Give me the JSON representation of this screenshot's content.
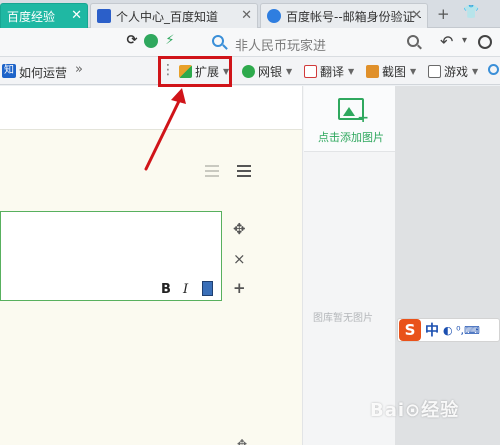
{
  "tabs": [
    {
      "label": "百度经验",
      "active": true,
      "close": "✕"
    },
    {
      "label": "个人中心_百度知道",
      "active": false,
      "close": "✕"
    },
    {
      "label": "百度帐号--邮箱身份验证 -",
      "active": false,
      "close": "✕"
    }
  ],
  "tabbar": {
    "new_tab": "+",
    "skin": "👕"
  },
  "addressbar": {
    "text": "非人民币玩家进",
    "undo": "↶",
    "caret": "▾"
  },
  "bookmarks": {
    "label": "如何运营",
    "icon_text": "知",
    "more": "»"
  },
  "toolbar_dots": "⋮",
  "extensions": [
    {
      "label": "扩展",
      "icon": "puzzle-icon",
      "color": "#e8a12a"
    },
    {
      "label": "网银",
      "icon": "bank-icon",
      "color": "#2eaa4c"
    },
    {
      "label": "翻译",
      "icon": "translate-icon",
      "color": "#d13a3a"
    },
    {
      "label": "截图",
      "icon": "scissors-icon",
      "color": "#e0902a"
    },
    {
      "label": "游戏",
      "icon": "game-icon",
      "color": "#6a6a6a"
    }
  ],
  "editor": {
    "format_bold": "B",
    "format_italic": "I",
    "move": "✥",
    "delete": "×",
    "add": "+"
  },
  "image_panel": {
    "add_label": "点击添加图片",
    "empty_label": "图库暂无图片"
  },
  "ime": {
    "s": "S",
    "zh": "中",
    "symbols": "◐ ⁰,⌨"
  },
  "watermark": "Bai⊙经验",
  "colors": {
    "accent": "#1fb8a3",
    "highlight": "#d01419",
    "green": "#2fa85e"
  }
}
